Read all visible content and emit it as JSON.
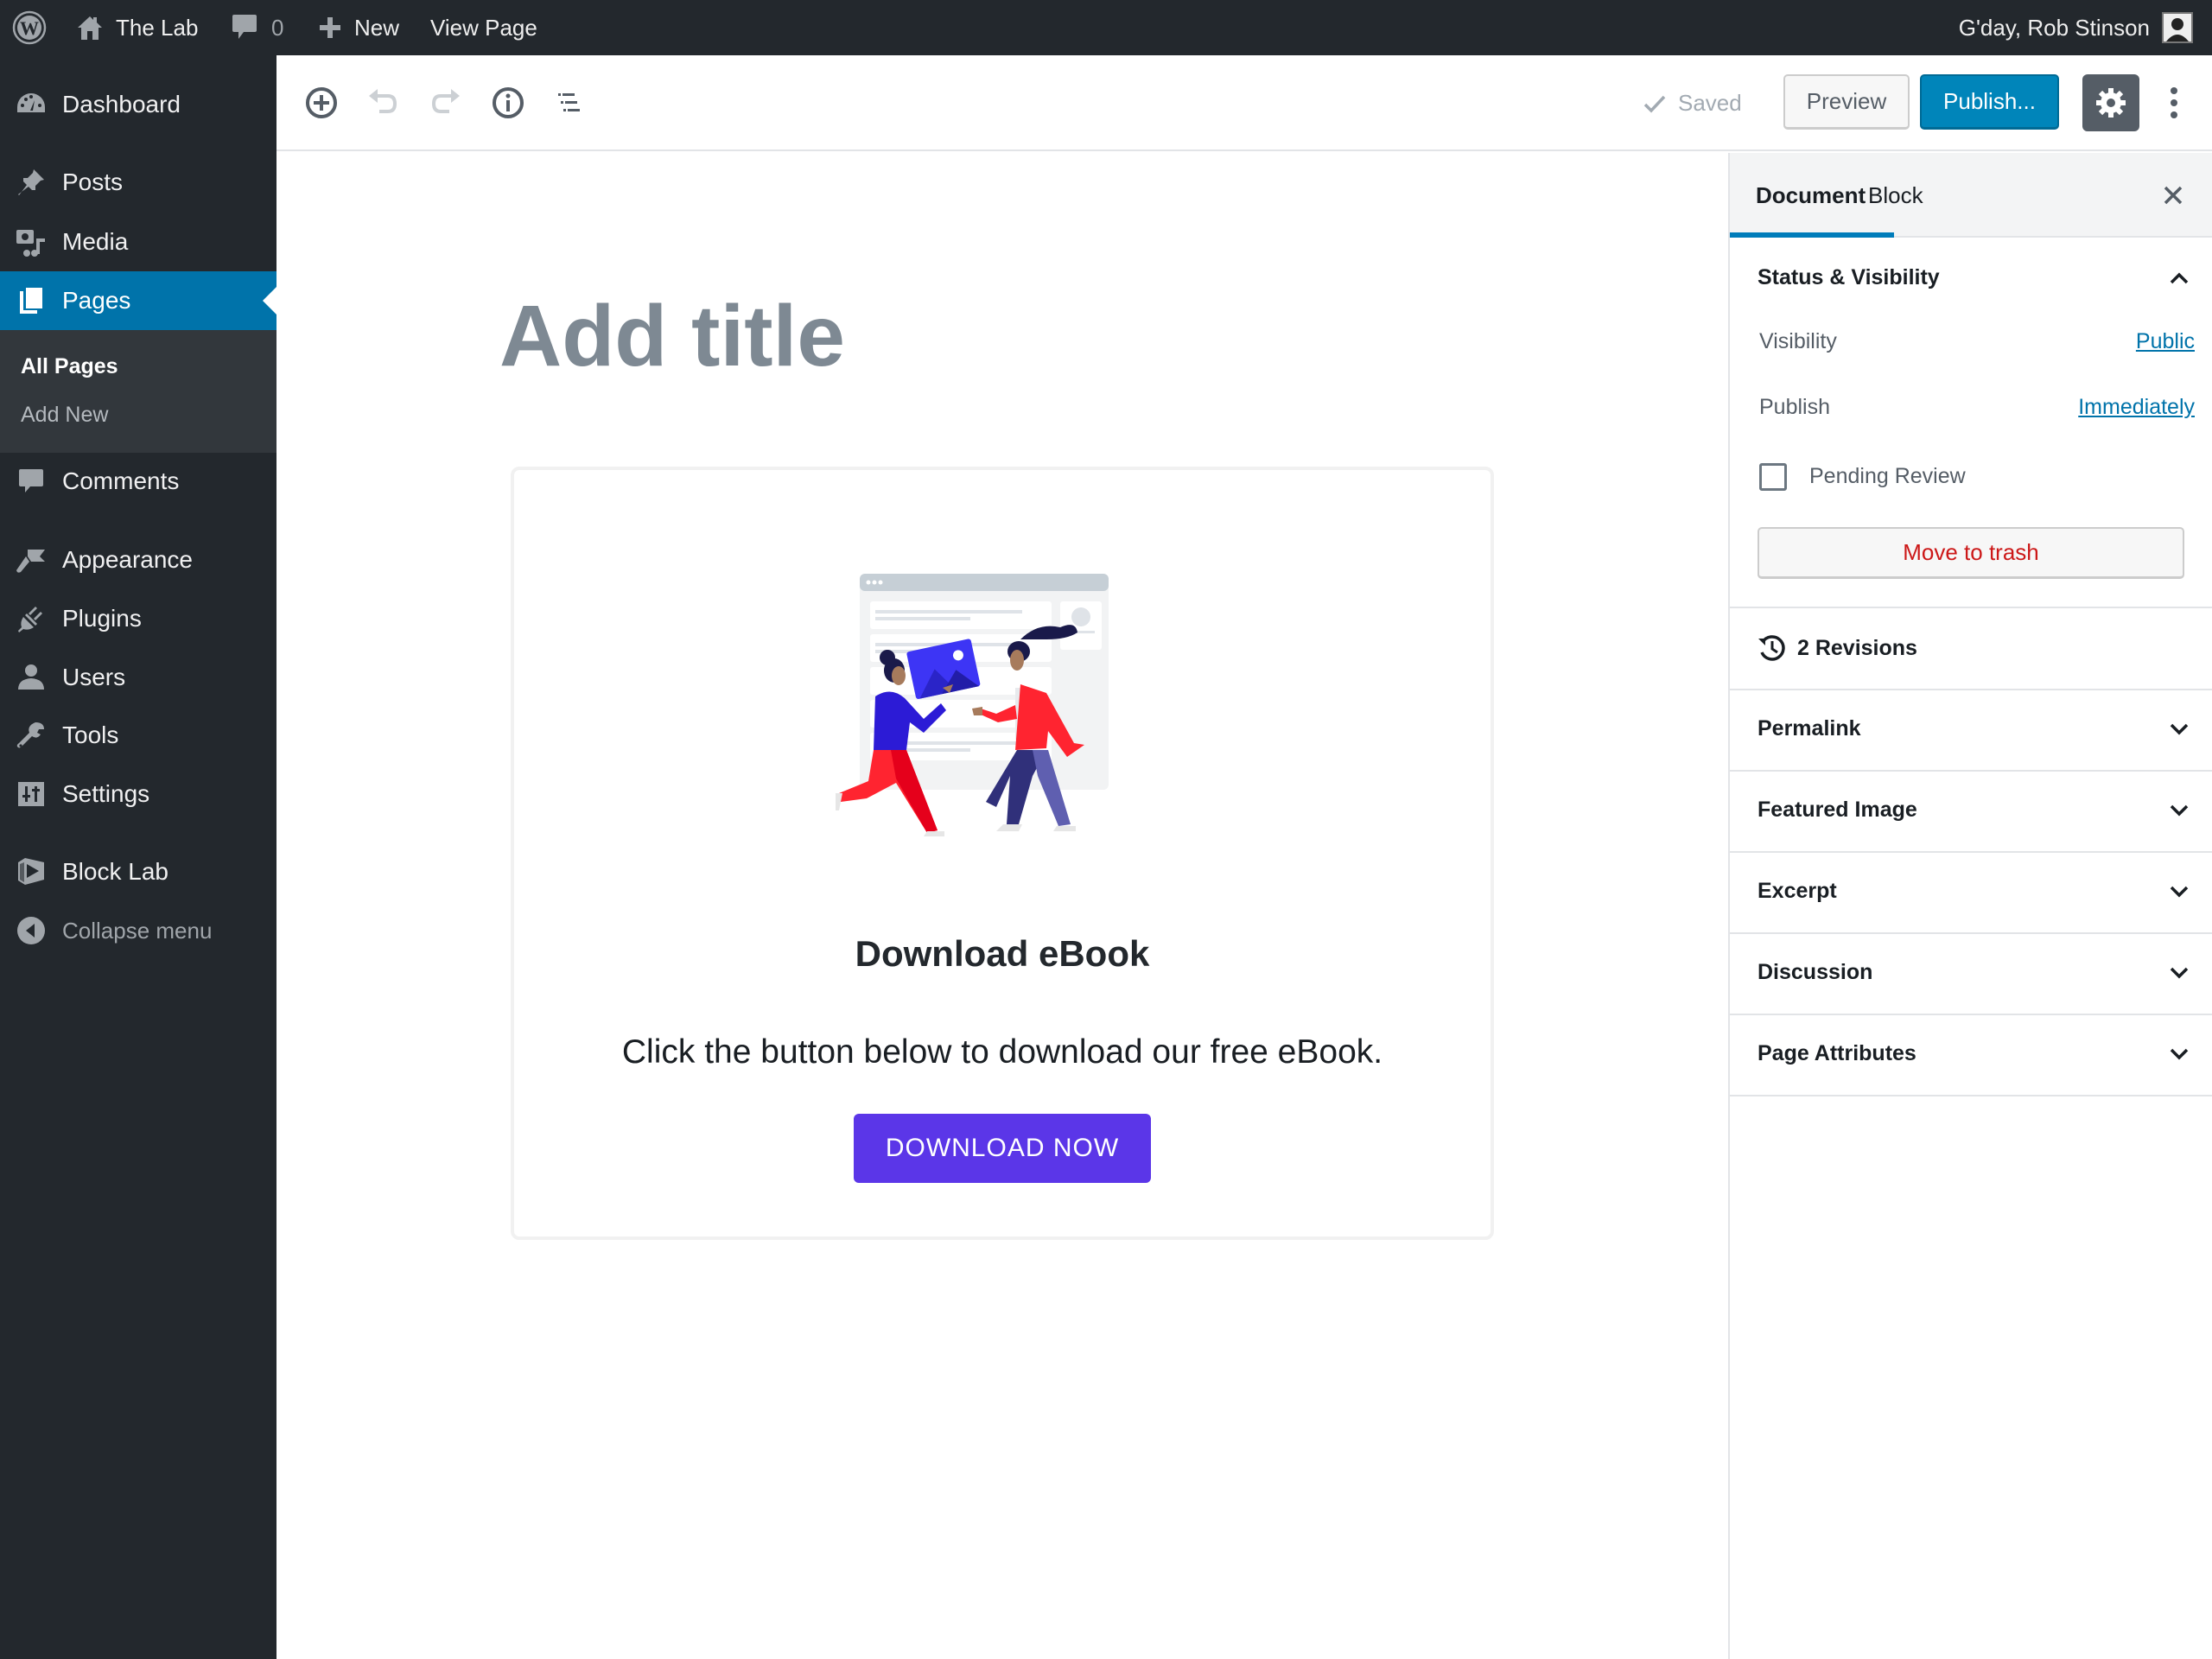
{
  "admin_bar": {
    "wp_logo_icon": "wordpress-logo",
    "site_name": "The Lab",
    "site_icon": "home-icon",
    "comments_icon": "comment-bubble-icon",
    "comments_count": "0",
    "new_icon": "plus-icon",
    "new_label": "New",
    "view_page_label": "View Page",
    "greeting": "G'day, Rob Stinson",
    "avatar": "user-avatar"
  },
  "admin_menu": {
    "items": [
      {
        "label": "Dashboard",
        "icon": "dashboard-gauge-icon"
      },
      {
        "label": "Posts",
        "icon": "pushpin-icon"
      },
      {
        "label": "Media",
        "icon": "media-camera-music-icon"
      },
      {
        "label": "Pages",
        "icon": "pages-icon",
        "active": true
      },
      {
        "label": "Comments",
        "icon": "comment-bubble-icon"
      },
      {
        "label": "Appearance",
        "icon": "paintbrush-icon"
      },
      {
        "label": "Plugins",
        "icon": "plug-icon"
      },
      {
        "label": "Users",
        "icon": "user-icon"
      },
      {
        "label": "Tools",
        "icon": "wrench-icon"
      },
      {
        "label": "Settings",
        "icon": "sliders-icon"
      },
      {
        "label": "Block Lab",
        "icon": "block-lab-icon"
      }
    ],
    "submenu": [
      {
        "label": "All Pages",
        "current": true
      },
      {
        "label": "Add New"
      }
    ],
    "collapse_label": "Collapse menu"
  },
  "editor_header": {
    "toolbar": [
      {
        "name": "add-block",
        "icon": "plus-circle-icon"
      },
      {
        "name": "undo",
        "icon": "undo-icon",
        "disabled": true
      },
      {
        "name": "redo",
        "icon": "redo-icon",
        "disabled": true
      },
      {
        "name": "content-info",
        "icon": "info-icon"
      },
      {
        "name": "block-navigation",
        "icon": "list-outline-icon"
      }
    ],
    "saved_label": "Saved",
    "preview_label": "Preview",
    "publish_label": "Publish...",
    "settings_icon": "gear-icon",
    "more_icon": "more-vertical-icon"
  },
  "editor": {
    "title_placeholder": "Add title",
    "ebook_block": {
      "heading": "Download eBook",
      "text": "Click the button below to download our free eBook.",
      "button_label": "DOWNLOAD NOW",
      "button_color": "#5b36e8",
      "illustration": "two-people-exchanging-image-illustration"
    }
  },
  "settings_sidebar": {
    "tabs": [
      {
        "label": "Document",
        "active": true
      },
      {
        "label": "Block"
      }
    ],
    "close_icon": "close-icon",
    "status_panel": {
      "title": "Status & Visibility",
      "expanded": true,
      "visibility_label": "Visibility",
      "visibility_value": "Public",
      "publish_label": "Publish",
      "publish_value": "Immediately",
      "pending_review_label": "Pending Review",
      "pending_review_checked": false,
      "trash_label": "Move to trash"
    },
    "revisions_label": "2 Revisions",
    "panels": [
      {
        "title": "Permalink"
      },
      {
        "title": "Featured Image"
      },
      {
        "title": "Excerpt"
      },
      {
        "title": "Discussion"
      },
      {
        "title": "Page Attributes"
      }
    ]
  },
  "colors": {
    "admin_dark": "#23282d",
    "admin_accent": "#0073aa",
    "publish_blue": "#0085ba",
    "trash_red": "#cc1818",
    "title_placeholder": "#7e8993"
  }
}
